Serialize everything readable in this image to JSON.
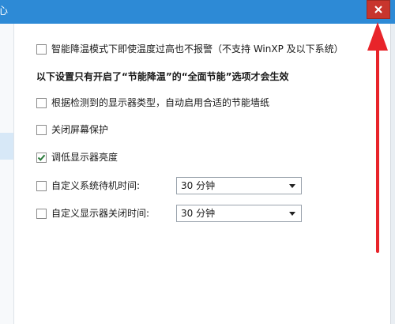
{
  "window": {
    "title_fragment": "心",
    "close_label": "✕"
  },
  "options": {
    "no_alarm_label": "智能降温模式下即使温度过高也不报警（不支持 WinXP 及以下系统）",
    "no_alarm_checked": false,
    "section_heading": "以下设置只有开启了“节能降温”的“全面节能”选项才会生效",
    "wallpaper_label": "根据检测到的显示器类型，自动启用合适的节能墙纸",
    "wallpaper_checked": false,
    "screensaver_label": "关闭屏幕保护",
    "screensaver_checked": false,
    "dim_label": "调低显示器亮度",
    "dim_checked": true,
    "standby_label": "自定义系统待机时间:",
    "standby_checked": false,
    "standby_value": "30 分钟",
    "monitor_off_label": "自定义显示器关闭时间:",
    "monitor_off_checked": false,
    "monitor_off_value": "30 分钟"
  },
  "colors": {
    "titlebar": "#2d8ad6",
    "close_button": "#c8352d",
    "checkmark": "#2a7a3a",
    "annotation_arrow": "#e8242a"
  },
  "icons": {
    "close": "close-icon",
    "check": "checkmark-icon",
    "dropdown": "chevron-down-icon",
    "annotation": "arrow-up-icon"
  }
}
